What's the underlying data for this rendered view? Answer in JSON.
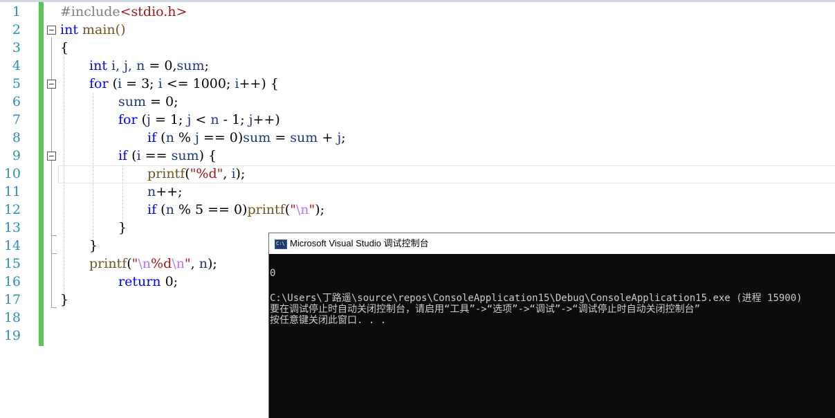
{
  "editor": {
    "line_numbers": [
      "1",
      "2",
      "3",
      "4",
      "5",
      "6",
      "7",
      "8",
      "9",
      "10",
      "11",
      "12",
      "13",
      "14",
      "15",
      "16",
      "17",
      "18",
      "19"
    ],
    "code": {
      "l1_include": "#include",
      "l1_header": "<stdio.h>",
      "l2_int": "int",
      "l2_main": " main()",
      "l3": "{",
      "l4_int": "int",
      "l4_i": " i, ",
      "l4_j": "j, ",
      "l4_n": "n",
      "l4_rest": " = 0,",
      "l4_sum": "sum",
      "l4_end": ";",
      "l5_for": "for",
      "l5_a": " (",
      "l5_i1": "i",
      "l5_b": " = 3; ",
      "l5_i2": "i",
      "l5_c": " <= 1000; ",
      "l5_i3": "i",
      "l5_d": "++) {",
      "l6_sum": "sum",
      "l6_rest": " = 0;",
      "l7_for": "for",
      "l7_a": " (",
      "l7_j1": "j",
      "l7_b": " = 1; ",
      "l7_j2": "j",
      "l7_c": " < ",
      "l7_n": "n",
      "l7_d": " - 1; ",
      "l7_j3": "j",
      "l7_e": "++)",
      "l8_if": "if",
      "l8_a": " (",
      "l8_n": "n",
      "l8_b": " % ",
      "l8_j1": "j",
      "l8_c": " == 0)",
      "l8_sum1": "sum",
      "l8_d": " = ",
      "l8_sum2": "sum",
      "l8_e": " + ",
      "l8_j2": "j",
      "l8_f": ";",
      "l9_if": "if",
      "l9_a": " (",
      "l9_i": "i",
      "l9_b": " == ",
      "l9_sum": "sum",
      "l9_c": ") {",
      "l10_printf": "printf",
      "l10_a": "(",
      "l10_q1": "\"",
      "l10_fmt": "%d",
      "l10_q2": "\"",
      "l10_b": ", ",
      "l10_i": "i",
      "l10_c": ");",
      "l11_n": "n",
      "l11_rest": "++;",
      "l12_if": "if",
      "l12_a": " (",
      "l12_n": "n",
      "l12_b": " % 5 == 0)",
      "l12_printf": "printf",
      "l12_c": "(",
      "l12_q1": "\"",
      "l12_esc": "\\n",
      "l12_q2": "\"",
      "l12_d": ");",
      "l13": "}",
      "l14": "}",
      "l15_printf": "printf",
      "l15_a": "(",
      "l15_q1": "\"",
      "l15_esc1": "\\n",
      "l15_fmt": "%d",
      "l15_esc2": "\\n",
      "l15_q2": "\"",
      "l15_b": ", ",
      "l15_n": "n",
      "l15_c": ");",
      "l16_return": "return",
      "l16_rest": " 0;",
      "l17": "}"
    }
  },
  "console": {
    "title": "Microsoft Visual Studio 调试控制台",
    "lines": [
      "0",
      "",
      "C:\\Users\\丁路遥\\source\\repos\\ConsoleApplication15\\Debug\\ConsoleApplication15.exe (进程 15900)",
      "要在调试停止时自动关闭控制台，请启用“工具”->“选项”->“调试”->“调试停止时自动关闭控制台”",
      "按任意键关闭此窗口. . ."
    ]
  },
  "colors": {
    "keyword": "#0000ff",
    "preprocessor": "#808080",
    "string": "#a31515",
    "variable": "#1f377f",
    "function": "#74531f",
    "escape": "#b776fb",
    "line_number": "#2b91af",
    "change_bar": "#59c653",
    "console_bg": "#0c0c0c",
    "console_text": "#cccccc"
  }
}
